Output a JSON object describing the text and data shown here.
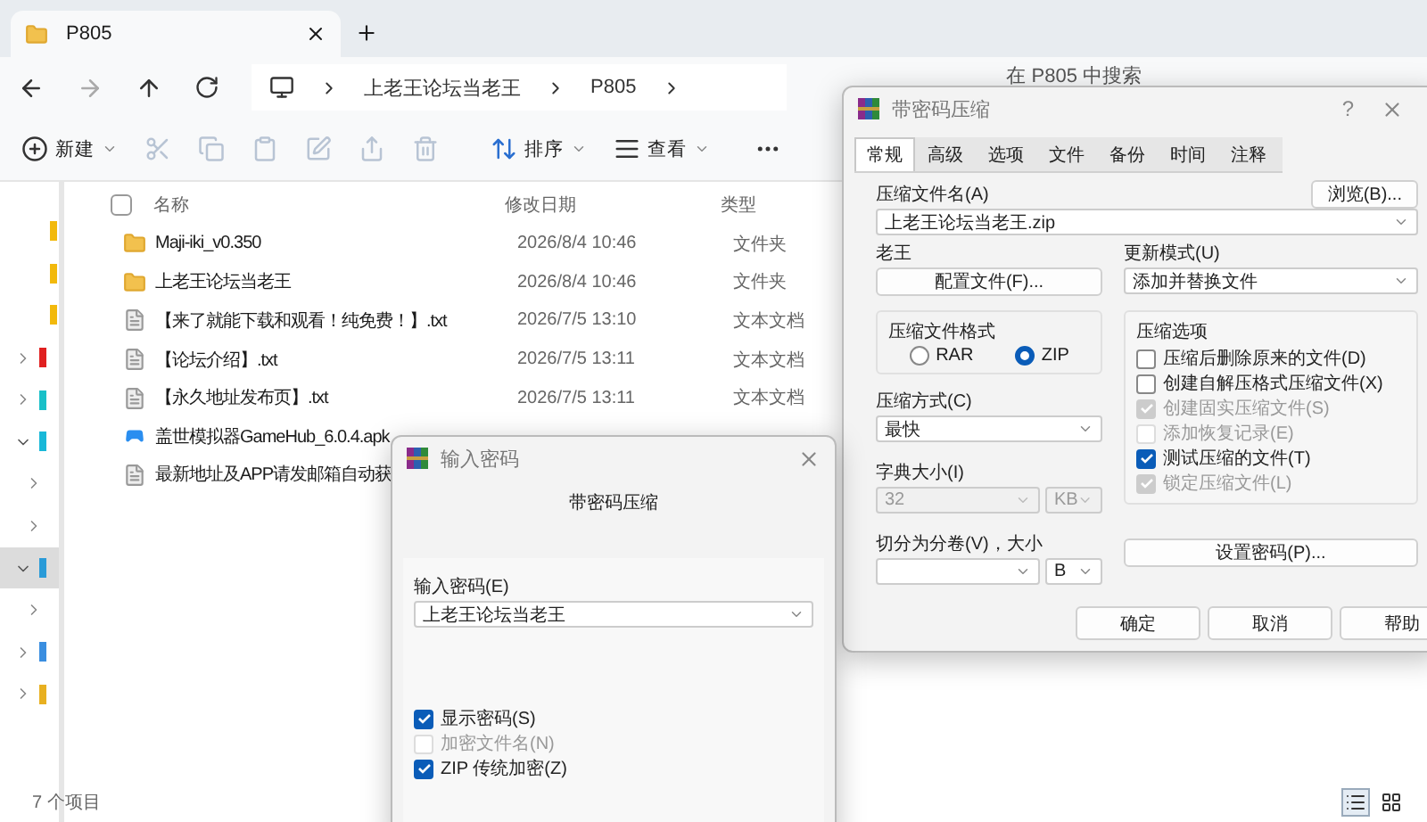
{
  "explorer": {
    "tabs": [
      {
        "label": "P805",
        "selected": true
      }
    ],
    "breadcrumb": [
      "上老王论坛当老王",
      "P805"
    ],
    "search": {
      "placeholder": "在 P805 中搜索"
    },
    "toolbar": [
      {
        "kind": "new",
        "label": "新建",
        "disabled": false
      },
      {
        "kind": "cut",
        "disabled": true
      },
      {
        "kind": "copy",
        "disabled": true
      },
      {
        "kind": "paste",
        "disabled": true
      },
      {
        "kind": "rename",
        "disabled": true
      },
      {
        "kind": "share",
        "disabled": true
      },
      {
        "kind": "delete",
        "disabled": true
      },
      {
        "kind": "sort",
        "label": "排序",
        "disabled": false
      },
      {
        "kind": "view",
        "label": "查看",
        "disabled": false
      },
      {
        "kind": "more",
        "disabled": false
      }
    ],
    "sidebar": [
      {
        "kind": "pinned",
        "color": "#f2b90c",
        "selected": false
      },
      {
        "kind": "pinned",
        "color": "#f2b90c",
        "selected": false
      },
      {
        "kind": "pinned",
        "color": "#f2b90c",
        "selected": false
      },
      {
        "kind": "node",
        "expanded": false,
        "color": "#e02020",
        "selected": false
      },
      {
        "kind": "node",
        "expanded": false,
        "color": "#18c0c8",
        "selected": false
      },
      {
        "kind": "node",
        "expanded": true,
        "color": "#18b8d8",
        "selected": false
      },
      {
        "kind": "child",
        "expanded": false,
        "selected": false
      },
      {
        "kind": "child",
        "expanded": false,
        "selected": false
      },
      {
        "kind": "node",
        "expanded": true,
        "color": "#2a9bd8",
        "selected": true
      },
      {
        "kind": "child",
        "expanded": false,
        "selected": false
      },
      {
        "kind": "node",
        "expanded": false,
        "color": "#3a8ee0",
        "selected": false
      },
      {
        "kind": "node",
        "expanded": false,
        "color": "#e8b020",
        "selected": false
      }
    ],
    "select_all": {
      "checked": false
    },
    "columns": [
      "名称",
      "修改日期",
      "类型"
    ],
    "files": [
      {
        "kind": "folder",
        "name": "Maji-iki_v0.350",
        "date": "2026/8/4 10:46",
        "type": "文件夹"
      },
      {
        "kind": "folder",
        "name": "上老王论坛当老王",
        "date": "2026/8/4 10:46",
        "type": "文件夹"
      },
      {
        "kind": "text",
        "name": "【来了就能下载和观看！纯免费！】.txt",
        "date": "2026/7/5 13:10",
        "type": "文本文档"
      },
      {
        "kind": "text",
        "name": "【论坛介绍】.txt",
        "date": "2026/7/5 13:11",
        "type": "文本文档"
      },
      {
        "kind": "text",
        "name": "【永久地址发布页】.txt",
        "date": "2026/7/5 13:11",
        "type": "文本文档"
      },
      {
        "kind": "apk",
        "name": "盖世模拟器GameHub_6.0.4.apk"
      },
      {
        "kind": "text",
        "name": "最新地址及APP请发邮箱自动获"
      }
    ],
    "status": "7 个项目",
    "view_modes": [
      {
        "kind": "details",
        "selected": true
      },
      {
        "kind": "tiles",
        "selected": false
      }
    ]
  },
  "archive_dialog": {
    "title": "带密码压缩",
    "help": "?",
    "tabs": [
      {
        "label": "常规",
        "selected": true
      },
      {
        "label": "高级",
        "selected": false
      },
      {
        "label": "选项",
        "selected": false
      },
      {
        "label": "文件",
        "selected": false
      },
      {
        "label": "备份",
        "selected": false
      },
      {
        "label": "时间",
        "selected": false
      },
      {
        "label": "注释",
        "selected": false
      }
    ],
    "archive_name": {
      "label": "压缩文件名(A)",
      "value": "上老王论坛当老王.zip",
      "browse": "浏览(B)..."
    },
    "profile": {
      "label": "老王",
      "button": "配置文件(F)..."
    },
    "update_mode": {
      "label": "更新模式(U)",
      "value": "添加并替换文件"
    },
    "format": {
      "label": "压缩文件格式",
      "options": [
        {
          "label": "RAR",
          "selected": false
        },
        {
          "label": "ZIP",
          "selected": true
        }
      ]
    },
    "method": {
      "label": "压缩方式(C)",
      "value": "最快"
    },
    "dictionary": {
      "label": "字典大小(I)",
      "value": "32",
      "unit": "KB",
      "disabled": true
    },
    "volumes": {
      "label": "切分为分卷(V)，大小",
      "unit": "B"
    },
    "options": {
      "label": "压缩选项",
      "items": [
        {
          "label": "压缩后删除原来的文件(D)",
          "checked": false,
          "disabled": false
        },
        {
          "label": "创建自解压格式压缩文件(X)",
          "checked": false,
          "disabled": false
        },
        {
          "label": "创建固实压缩文件(S)",
          "checked": true,
          "disabled": true
        },
        {
          "label": "添加恢复记录(E)",
          "checked": false,
          "disabled": true
        },
        {
          "label": "测试压缩的文件(T)",
          "checked": true,
          "disabled": false
        },
        {
          "label": "锁定压缩文件(L)",
          "checked": true,
          "disabled": true
        }
      ]
    },
    "set_password": "设置密码(P)...",
    "buttons": [
      "确定",
      "取消",
      "帮助"
    ]
  },
  "password_dialog": {
    "title": "输入密码",
    "heading": "带密码压缩",
    "field": {
      "label": "输入密码(E)",
      "value": "上老王论坛当老王"
    },
    "options": [
      {
        "label": "显示密码(S)",
        "checked": true,
        "disabled": false
      },
      {
        "label": "加密文件名(N)",
        "checked": false,
        "disabled": true
      },
      {
        "label": "ZIP 传统加密(Z)",
        "checked": true,
        "disabled": false
      }
    ]
  }
}
